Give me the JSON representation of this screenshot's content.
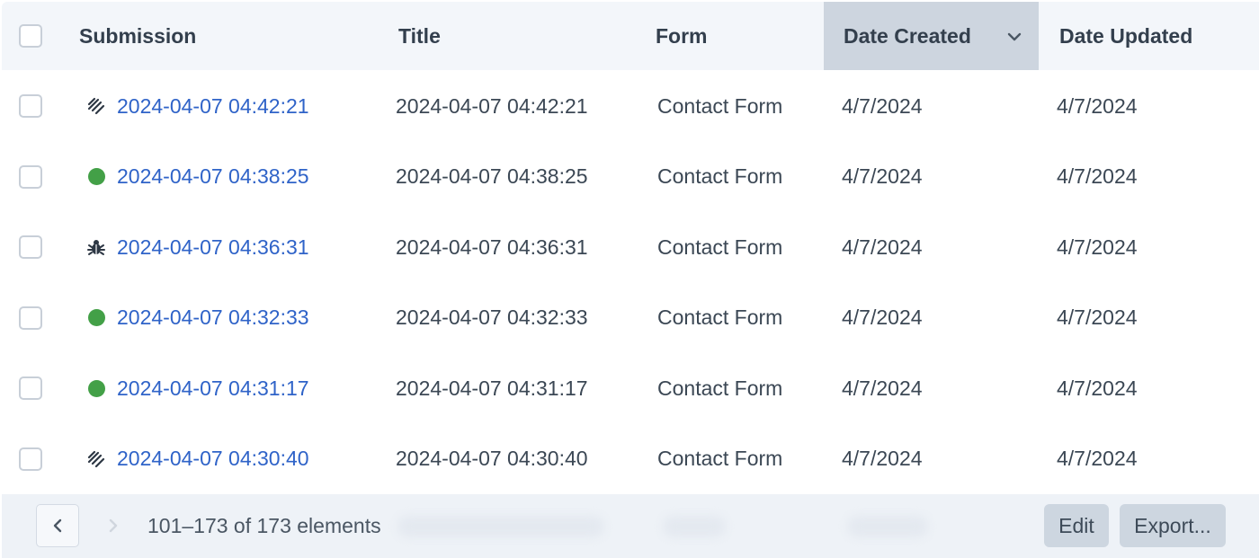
{
  "table": {
    "columns": {
      "submission": "Submission",
      "title": "Title",
      "form": "Form",
      "date_created": "Date Created",
      "date_updated": "Date Updated"
    },
    "sorted_column": "date_created",
    "sort_direction": "descending",
    "rows": [
      {
        "status_icon": "signature-icon",
        "submission": "2024-04-07 04:42:21",
        "title": "2024-04-07 04:42:21",
        "form": "Contact Form",
        "date_created": "4/7/2024",
        "date_updated": "4/7/2024"
      },
      {
        "status_icon": "green-dot-icon",
        "submission": "2024-04-07 04:38:25",
        "title": "2024-04-07 04:38:25",
        "form": "Contact Form",
        "date_created": "4/7/2024",
        "date_updated": "4/7/2024"
      },
      {
        "status_icon": "bug-icon",
        "submission": "2024-04-07 04:36:31",
        "title": "2024-04-07 04:36:31",
        "form": "Contact Form",
        "date_created": "4/7/2024",
        "date_updated": "4/7/2024"
      },
      {
        "status_icon": "green-dot-icon",
        "submission": "2024-04-07 04:32:33",
        "title": "2024-04-07 04:32:33",
        "form": "Contact Form",
        "date_created": "4/7/2024",
        "date_updated": "4/7/2024"
      },
      {
        "status_icon": "green-dot-icon",
        "submission": "2024-04-07 04:31:17",
        "title": "2024-04-07 04:31:17",
        "form": "Contact Form",
        "date_created": "4/7/2024",
        "date_updated": "4/7/2024"
      },
      {
        "status_icon": "signature-icon",
        "submission": "2024-04-07 04:30:40",
        "title": "2024-04-07 04:30:40",
        "form": "Contact Form",
        "date_created": "4/7/2024",
        "date_updated": "4/7/2024"
      }
    ]
  },
  "footer": {
    "pagination_text": "101–173 of 173 elements",
    "edit_label": "Edit",
    "export_label": "Export..."
  },
  "colors": {
    "link": "#2f63c8",
    "status_live": "#43a047",
    "header_bg": "#f3f6fa",
    "sorted_header_bg": "#cdd5df"
  }
}
